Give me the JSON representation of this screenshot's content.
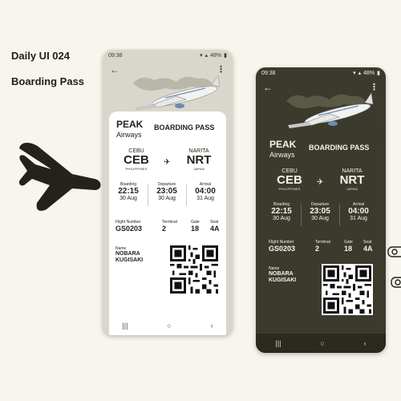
{
  "captions": {
    "line1": "Daily UI 024",
    "line2": "Boarding Pass"
  },
  "colors": {
    "background": "#f6f5ee",
    "dark_theme": "#3b3a2c",
    "light_phone": "#d9d7cb",
    "ink": "#23221b"
  },
  "icons": {
    "big_plane": "airplane-silhouette-icon",
    "route": "plane-icon"
  },
  "light_phone": {
    "time": "09:38",
    "battery": "48%"
  },
  "dark_phone": {
    "time": "09:38",
    "battery": "48%"
  },
  "pass": {
    "brand_name": "PEAK",
    "brand_sub": "Airways",
    "title": "BOARDING PASS",
    "from": {
      "city": "CEBU",
      "code": "CEB",
      "country": "PHILIPPINES"
    },
    "to": {
      "city": "NARITA",
      "code": "NRT",
      "country": "JAPAN"
    },
    "boarding": {
      "label": "Boarding",
      "time": "22:15",
      "date": "30 Aug"
    },
    "departure": {
      "label": "Departure",
      "time": "23:05",
      "date": "30 Aug"
    },
    "arrival": {
      "label": "Arrival",
      "time": "04:00",
      "date": "31 Aug"
    },
    "flight": {
      "label": "Flight Number",
      "value": "GS0203"
    },
    "terminal": {
      "label": "Terminal",
      "value": "2"
    },
    "gate": {
      "label": "Gate",
      "value": "18"
    },
    "seat": {
      "label": "Seat",
      "value": "4A"
    },
    "name": {
      "label": "Name",
      "first": "NOBARA",
      "last": "KUGISAKI"
    }
  },
  "nav": {
    "recents": "|||",
    "home": "○",
    "back": "‹"
  }
}
